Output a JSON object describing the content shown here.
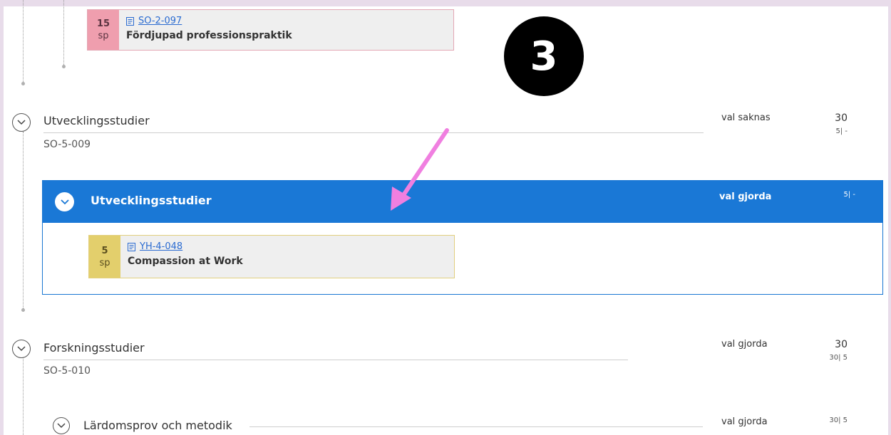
{
  "badge": "3",
  "top_course": {
    "credits": "15",
    "unit": "sp",
    "code": "SO-2-097",
    "name": "Fördjupad professionspraktik"
  },
  "sections": [
    {
      "title": "Utvecklingsstudier",
      "code": "SO-5-009",
      "status": "val saknas",
      "credits": "30",
      "credits_sub": "5| -"
    },
    {
      "title": "Forskningsstudier",
      "code": "SO-5-010",
      "status": "val gjorda",
      "credits": "30",
      "credits_sub": "30| 5"
    }
  ],
  "selected_group": {
    "title": "Utvecklingsstudier",
    "status": "val gjorda",
    "credits_sub": "5| -",
    "course": {
      "credits": "5",
      "unit": "sp",
      "code": "YH-4-048",
      "name": "Compassion at Work"
    }
  },
  "subsection": {
    "title": "Lärdomsprov och metodik",
    "status": "val gjorda",
    "credits_sub": "30| 5"
  },
  "icons": {
    "chevron": "chevron-down-icon",
    "document": "document-icon",
    "arrow": "pink-arrow-annotation"
  },
  "colors": {
    "accent": "#1a78d6",
    "pink_card": "#ef9eae",
    "yellow_card": "#e3cf6c",
    "arrow": "#f07fe0"
  }
}
